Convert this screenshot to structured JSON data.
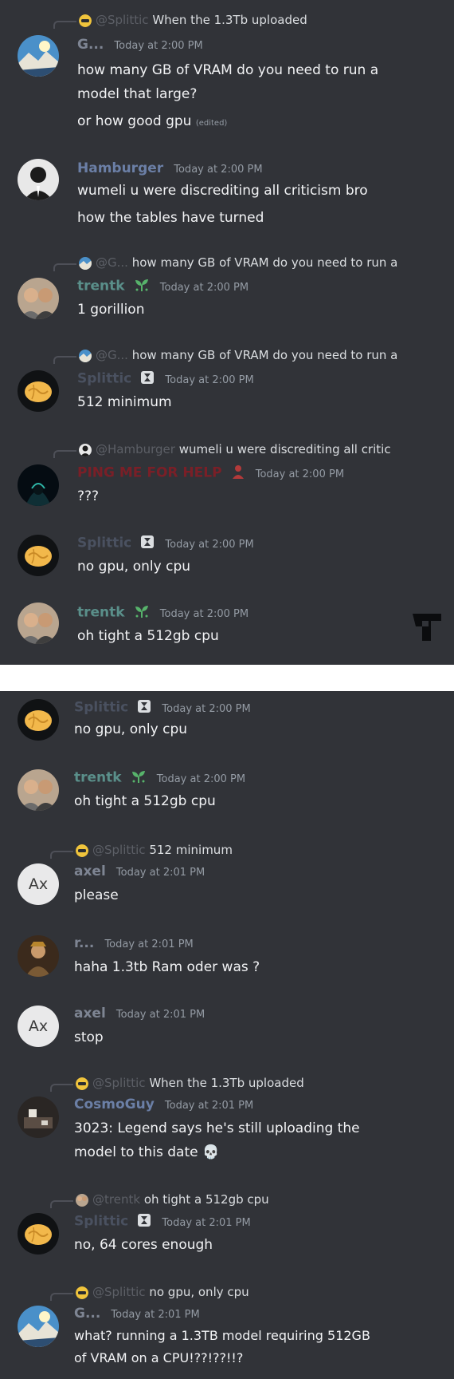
{
  "panels": [
    {
      "messages": [
        {
          "reply": {
            "name": "@Splittic",
            "text": "When the 1.3Tb uploaded",
            "avatar": "emoji-avatar"
          },
          "author": "G...",
          "author_color": "#7e8593",
          "avatar": "landscape-avatar",
          "time": "Today at 2:00 PM",
          "lines": [
            "how many GB of VRAM do you need to run a",
            "model that large?",
            "or how good gpu"
          ],
          "edited": "(edited)"
        },
        {
          "author": "Hamburger",
          "author_color": "#6b7fa6",
          "avatar": "suit-avatar",
          "time": "Today at 2:00 PM",
          "lines": [
            "wumeli u were discrediting all criticism bro",
            "how the tables have turned"
          ]
        },
        {
          "reply": {
            "name": "@G...",
            "text": "how many GB of VRAM do you need to run a",
            "avatar": "landscape-avatar"
          },
          "author": "trentk",
          "author_color": "#5a8f8a",
          "avatar": "people-avatar",
          "badge": "sprout-icon",
          "time": "Today at 2:00 PM",
          "lines": [
            "1 gorillion"
          ]
        },
        {
          "reply": {
            "name": "@G...",
            "text": "how many GB of VRAM do you need to run a",
            "avatar": "landscape-avatar"
          },
          "author": "Splittic",
          "author_color": "#4a5160",
          "avatar": "brain-avatar",
          "badge": "hourglass-icon",
          "time": "Today at 2:00 PM",
          "lines": [
            "512 minimum"
          ]
        },
        {
          "reply": {
            "name": "@Hamburger",
            "text": "wumeli u were discrediting all critic",
            "avatar": "suit-avatar"
          },
          "author": "PING ME FOR HELP",
          "author_color": "#7a1f27",
          "avatar": "hacker-avatar",
          "badge": "person-icon",
          "time": "Today at 2:00 PM",
          "lines": [
            "???"
          ]
        },
        {
          "author": "Splittic",
          "author_color": "#4a5160",
          "avatar": "brain-avatar",
          "badge": "hourglass-icon",
          "time": "Today at 2:00 PM",
          "lines": [
            "no gpu, only cpu"
          ]
        },
        {
          "author": "trentk",
          "author_color": "#5a8f8a",
          "avatar": "people-avatar",
          "badge": "sprout-icon",
          "time": "Today at 2:00 PM",
          "lines": [
            "oh tight a 512gb cpu"
          ]
        }
      ]
    },
    {
      "messages": [
        {
          "author": "Splittic",
          "author_color": "#4a5160",
          "avatar": "brain-avatar",
          "badge": "hourglass-icon",
          "time": "Today at 2:00 PM",
          "lines": [
            "no gpu, only cpu"
          ]
        },
        {
          "author": "trentk",
          "author_color": "#5a8f8a",
          "avatar": "people-avatar",
          "badge": "sprout-icon",
          "time": "Today at 2:00 PM",
          "lines": [
            "oh tight a 512gb cpu"
          ]
        },
        {
          "reply": {
            "name": "@Splittic",
            "text": "512 minimum",
            "avatar": "emoji-avatar"
          },
          "author": "axel",
          "author_color": "#7e8593",
          "avatar": "initials-avatar",
          "avatar_text": "Ax",
          "time": "Today at 2:01 PM",
          "lines": [
            "please"
          ]
        },
        {
          "author": "r...",
          "author_color": "#7e8593",
          "avatar": "warrior-avatar",
          "time": "Today at 2:01 PM",
          "lines": [
            "haha 1.3tb Ram oder was ?"
          ]
        },
        {
          "author": "axel",
          "author_color": "#7e8593",
          "avatar": "initials-avatar",
          "avatar_text": "Ax",
          "time": "Today at 2:01 PM",
          "lines": [
            "stop"
          ]
        },
        {
          "reply": {
            "name": "@Splittic",
            "text": "When the 1.3Tb uploaded",
            "avatar": "emoji-avatar"
          },
          "author": "CosmoGuy",
          "author_color": "#6b7fa6",
          "avatar": "room-avatar",
          "time": "Today at 2:01 PM",
          "lines": [
            "3023: Legend says he's still uploading the",
            "model to this date 💀"
          ]
        },
        {
          "reply": {
            "name": "@trentk",
            "text": "oh tight a 512gb cpu",
            "avatar": "people-avatar"
          },
          "author": "Splittic",
          "author_color": "#4a5160",
          "avatar": "brain-avatar",
          "badge": "hourglass-icon",
          "time": "Today at 2:01 PM",
          "lines": [
            "no, 64 cores enough"
          ]
        },
        {
          "reply": {
            "name": "@Splittic",
            "text": "no gpu, only cpu",
            "avatar": "emoji-avatar"
          },
          "author": "G...",
          "author_color": "#7e8593",
          "avatar": "landscape-avatar",
          "time": "Today at 2:01 PM",
          "lines": [
            "what? running a 1.3TB model requiring 512GB",
            "of VRAM on a CPU!??!??!!?"
          ]
        }
      ]
    }
  ],
  "logo": "t-logo-icon",
  "colors": {
    "panel_bg": "#313338",
    "page_bg": "#ffffff",
    "text": "#f2f3f5",
    "timestamp": "#949ba4"
  }
}
